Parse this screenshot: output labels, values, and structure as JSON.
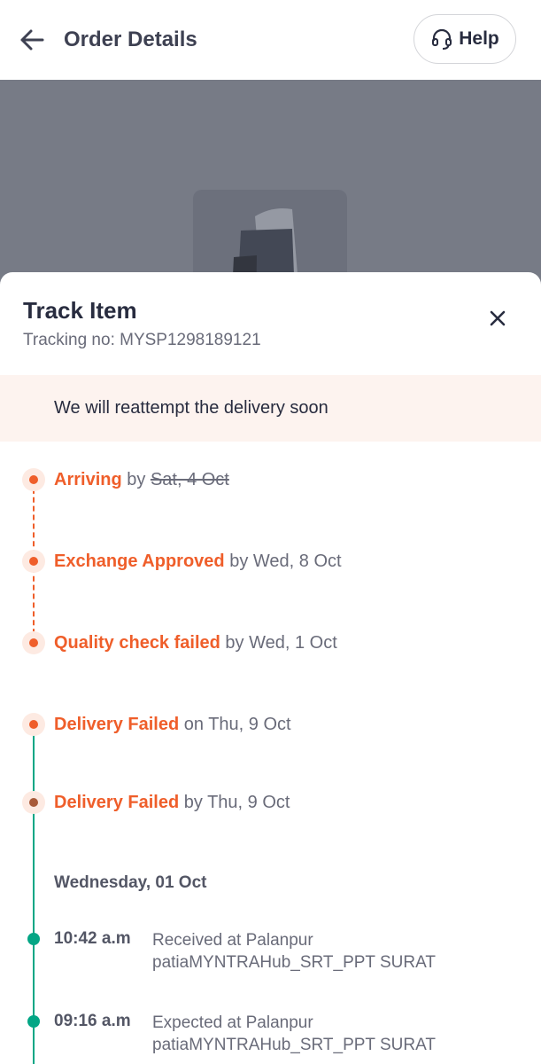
{
  "header": {
    "title": "Order Details",
    "help_label": "Help"
  },
  "sheet": {
    "title": "Track Item",
    "tracking_label": "Tracking no: MYSP1298189121",
    "banner": "We will reattempt the delivery soon",
    "steps": [
      {
        "status": "Arriving",
        "prep": "by",
        "date": "Sat, 4 Oct",
        "struck": true
      },
      {
        "status": "Exchange Approved",
        "prep": "by",
        "date": "Wed, 8 Oct"
      },
      {
        "status": "Quality check failed",
        "prep": "by",
        "date": "Wed, 1 Oct"
      },
      {
        "status": "Delivery Failed",
        "prep": "on",
        "date": "Thu, 9 Oct"
      },
      {
        "status": "Delivery Failed",
        "prep": "by",
        "date": "Thu, 9 Oct"
      }
    ],
    "day_heading": "Wednesday, 01 Oct",
    "events": [
      {
        "time": "10:42 a.m",
        "line1": "Received at Palanpur",
        "line2": "patiaMYNTRAHub_SRT_PPT SURAT"
      },
      {
        "time": "09:16 a.m",
        "line1": "Expected at Palanpur",
        "line2": "patiaMYNTRAHub_SRT_PPT SURAT"
      }
    ]
  },
  "colors": {
    "accent": "#ef5e2a",
    "success": "#03a685",
    "banner_bg": "#fdf3ef"
  }
}
